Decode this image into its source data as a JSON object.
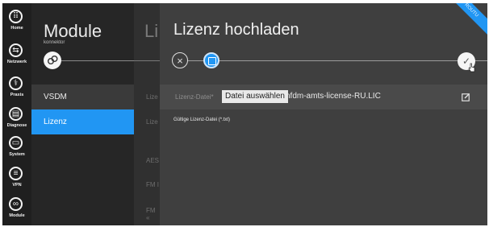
{
  "rail": [
    {
      "label": "Home",
      "icon": "apps-grid-icon"
    },
    {
      "label": "Netzwerk",
      "icon": "network-icon"
    },
    {
      "label": "Praxis",
      "icon": "medical-icon"
    },
    {
      "label": "Diagnose",
      "icon": "clipboard-icon"
    },
    {
      "label": "System",
      "icon": "system-icon"
    },
    {
      "label": "VPN",
      "icon": "vpn-icon"
    },
    {
      "label": "Module",
      "icon": "modules-icon"
    }
  ],
  "module_column": {
    "title": "Module",
    "subtitle": "konnektor",
    "items": [
      {
        "label": "VSDM"
      },
      {
        "label": "Lizenz"
      }
    ]
  },
  "third_column": {
    "title": "Li",
    "rows": [
      "Lize",
      "Lize",
      "AES",
      "FM I",
      "FM «"
    ]
  },
  "panel": {
    "title": "Lizenz hochladen",
    "ribbon": "ROUTU",
    "upload": {
      "label": "Lizenz-Datei*",
      "button": "Datei auswählen",
      "filename": "nfdm-amts-license-RU.LIC"
    },
    "hint": "Gültige Lizenz-Datei (*.txt)"
  },
  "colors": {
    "accent": "#2196f3",
    "background": "#2a2a2a",
    "panel": "#3f3f3f"
  }
}
